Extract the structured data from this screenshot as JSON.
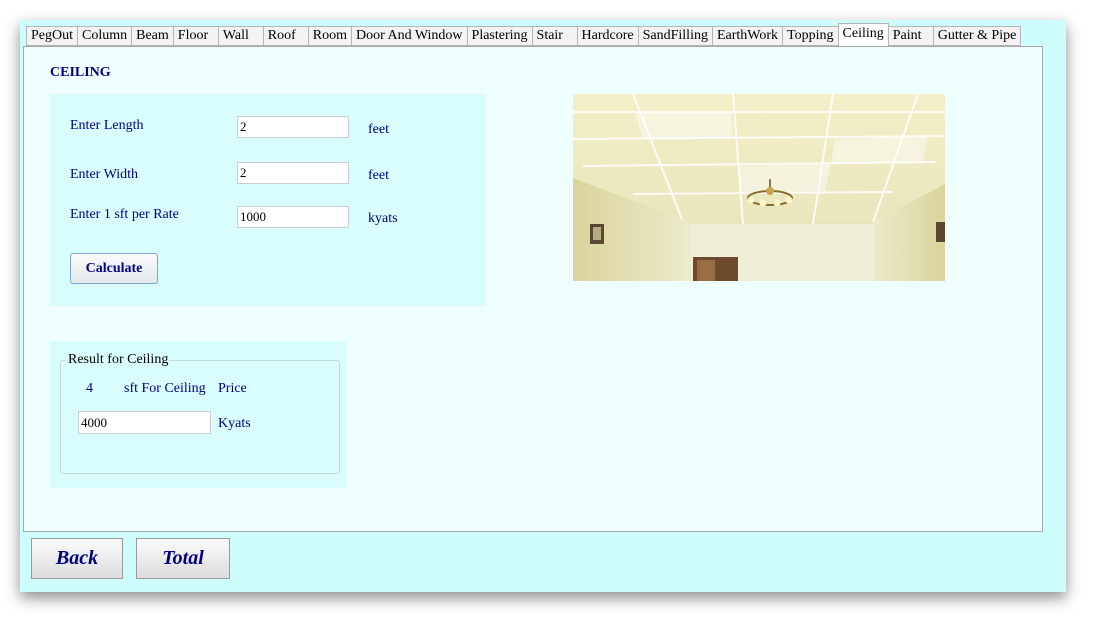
{
  "tabs": [
    "PegOut",
    "Column",
    "Beam",
    "Floor",
    "Wall",
    "Roof",
    "Room",
    "Door And Window",
    "Plastering",
    "Stair",
    "Hardcore",
    "SandFilling",
    "EarthWork",
    "Topping",
    "Ceiling",
    "Paint",
    "Gutter & Pipe"
  ],
  "active_tab": "Ceiling",
  "section_title": "CEILING",
  "inputs": {
    "length_label": "Enter Length",
    "length_value": "2",
    "length_unit": "feet",
    "width_label": "Enter Width",
    "width_value": "2",
    "width_unit": "feet",
    "rate_label": "Enter 1 sft per Rate",
    "rate_value": "1000",
    "rate_unit": "kyats",
    "calculate_label": "Calculate"
  },
  "result": {
    "legend": "Result for Ceiling",
    "area": "4",
    "area_text": "sft For Ceiling",
    "price_label": "Price",
    "price_value": "4000",
    "price_unit": "Kyats"
  },
  "bottom": {
    "back_label": "Back",
    "total_label": "Total"
  },
  "colors": {
    "window_bg": "#cdfdfd",
    "text_navy": "#000080",
    "panel_bg": "#effefe"
  }
}
